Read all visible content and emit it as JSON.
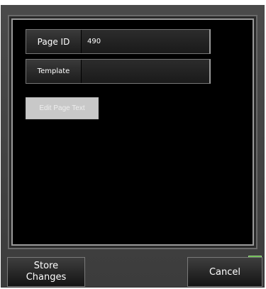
{
  "fields": {
    "page_id": {
      "label": "Page ID",
      "value": "490"
    },
    "template": {
      "label": "Template",
      "value": ""
    }
  },
  "buttons": {
    "edit_page_text": "Edit Page Text",
    "store_changes_line1": "Store",
    "store_changes_line2": "Changes",
    "cancel": "Cancel"
  },
  "status": {
    "indicator_color": "#5ab43c"
  }
}
